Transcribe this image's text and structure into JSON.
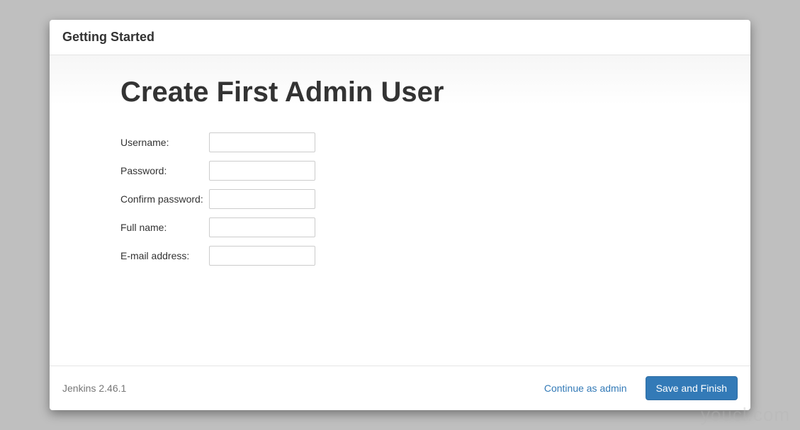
{
  "header": {
    "title": "Getting Started"
  },
  "main": {
    "heading": "Create First Admin User",
    "form": {
      "username_label": "Username:",
      "username_value": "",
      "password_label": "Password:",
      "password_value": "",
      "confirm_password_label": "Confirm password:",
      "confirm_password_value": "",
      "fullname_label": "Full name:",
      "fullname_value": "",
      "email_label": "E-mail address:",
      "email_value": ""
    }
  },
  "footer": {
    "version": "Jenkins 2.46.1",
    "continue_label": "Continue as admin",
    "save_label": "Save and Finish"
  },
  "watermark": "youcl.com"
}
